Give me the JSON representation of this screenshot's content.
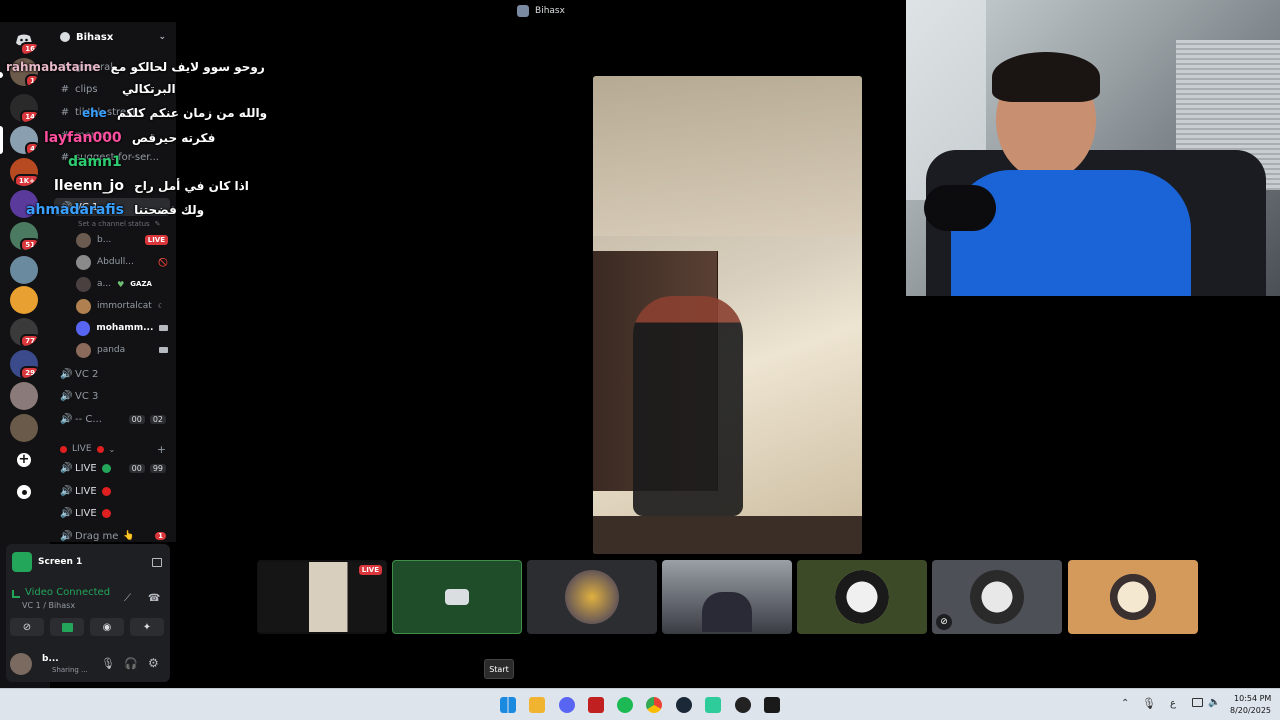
{
  "window": {
    "title": "Bihasx"
  },
  "server": {
    "name": "Bihasx"
  },
  "rail": {
    "badges": [
      "16",
      "1",
      "14",
      "4",
      "1K+",
      "51",
      "77",
      "29"
    ]
  },
  "channels": {
    "text": [
      {
        "name": "general"
      },
      {
        "name": "clips"
      },
      {
        "name": "tiktok-stream"
      },
      {
        "name": "memes"
      },
      {
        "name": "suggest-for-ser..."
      }
    ],
    "vc1": {
      "name": "VC 1",
      "status_placeholder": "Set a channel status"
    },
    "vc1_users": [
      {
        "name": "b...",
        "live": "LIVE"
      },
      {
        "name": "Abdull..."
      },
      {
        "name": "a...",
        "tag": "GAZA"
      },
      {
        "name": "immortalcat"
      },
      {
        "name": "mohamm..."
      },
      {
        "name": "panda"
      }
    ],
    "voice": [
      {
        "name": "VC 2"
      },
      {
        "name": "VC 3"
      },
      {
        "name": "-- C...",
        "a": "00",
        "b": "02"
      }
    ],
    "live_category": "LIVE",
    "live": [
      {
        "name": "LIVE",
        "a": "00",
        "b": "99"
      },
      {
        "name": "LIVE"
      },
      {
        "name": "LIVE"
      },
      {
        "name": "Drag me",
        "badge": "1"
      }
    ]
  },
  "share": {
    "label": "Screen 1"
  },
  "voice_status": {
    "status": "Video Connected",
    "channel": "VC 1 / Bihasx"
  },
  "user": {
    "name": "b...",
    "status": "Sharing ..."
  },
  "chat": [
    {
      "user": "rahmabataine",
      "msg": "روحو سوو لايف لحالكو مع",
      "color": "#ffffff"
    },
    {
      "user": "",
      "msg": "البرتكالي",
      "color": "#ffffff"
    },
    {
      "user": "ehe",
      "msg": "والله من زمان عنكم كلكم",
      "color": "#3aa0ff"
    },
    {
      "user": "layfan000",
      "msg": "فكرته حيرقص",
      "color": "#ff4fa0"
    },
    {
      "user": "damn1",
      "msg": "",
      "color": "#2ecc71"
    },
    {
      "user": "lleenn_jo",
      "msg": "اذا كان في أمل راح",
      "color": "#ffffff"
    },
    {
      "user": "ahmadarafis",
      "msg": "ولك فضحتنا",
      "color": "#3aa0ff"
    }
  ],
  "tiles": {
    "live_label": "LIVE"
  },
  "tooltip": {
    "label": "Start"
  },
  "tray": {
    "lang": "ع",
    "time": "10:54 PM",
    "date": "8/20/2025"
  }
}
